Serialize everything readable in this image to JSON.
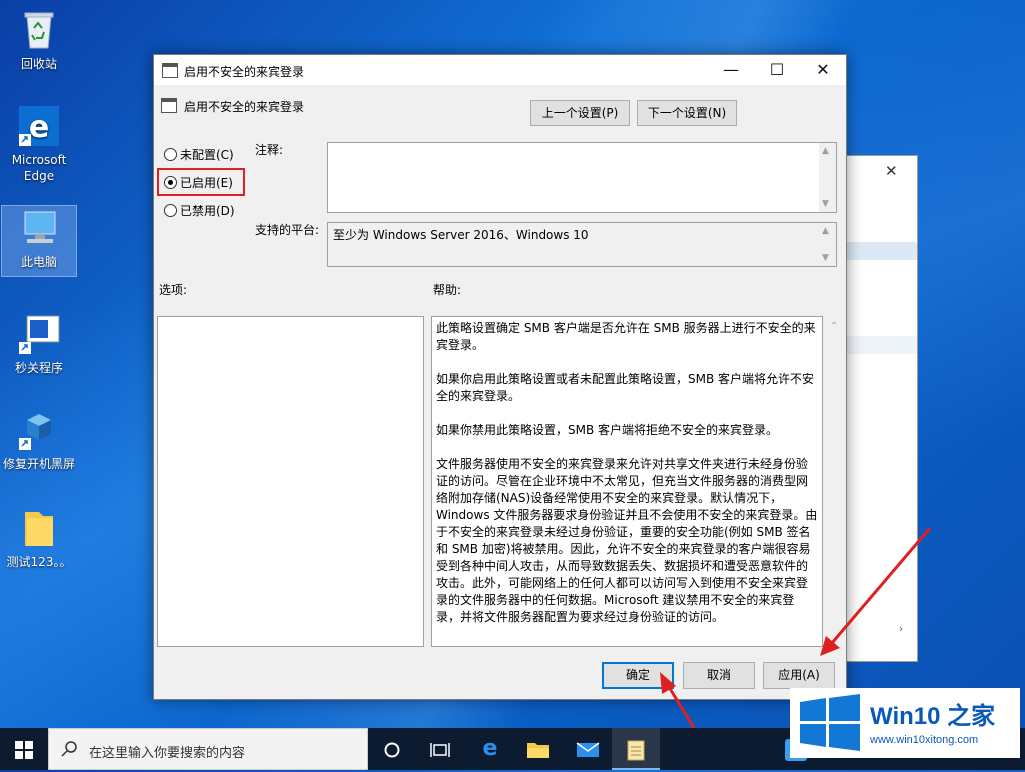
{
  "desktop": {
    "icons": [
      {
        "label": "回收站",
        "icon": "recycle-bin-icon"
      },
      {
        "label": "Microsoft Edge",
        "icon": "edge-icon"
      },
      {
        "label": "此电脑",
        "icon": "computer-icon"
      },
      {
        "label": "秒关程序",
        "icon": "program-icon"
      },
      {
        "label": "修复开机黑屏",
        "icon": "repair-icon"
      },
      {
        "label": "测试123。。",
        "icon": "folder-icon"
      }
    ]
  },
  "dialog": {
    "window_title": "启用不安全的来宾登录",
    "policy_name": "启用不安全的来宾登录",
    "prev_button": "上一个设置(P)",
    "next_button": "下一个设置(N)",
    "radio_options": [
      {
        "label": "未配置(C)",
        "checked": false
      },
      {
        "label": "已启用(E)",
        "checked": true
      },
      {
        "label": "已禁用(D)",
        "checked": false
      }
    ],
    "comment_label": "注释:",
    "comment_value": "",
    "platform_label": "支持的平台:",
    "platform_value": "至少为 Windows Server 2016、Windows 10",
    "options_label": "选项:",
    "help_label": "帮助:",
    "help_paragraphs": [
      "此策略设置确定 SMB 客户端是否允许在 SMB 服务器上进行不安全的来宾登录。",
      "如果你启用此策略设置或者未配置此策略设置，SMB 客户端将允许不安全的来宾登录。",
      "如果你禁用此策略设置，SMB 客户端将拒绝不安全的来宾登录。",
      "文件服务器使用不安全的来宾登录来允许对共享文件夹进行未经身份验证的访问。尽管在企业环境中不太常见，但充当文件服务器的消费型网络附加存储(NAS)设备经常使用不安全的来宾登录。默认情况下，Windows 文件服务器要求身份验证并且不会使用不安全的来宾登录。由于不安全的来宾登录未经过身份验证，重要的安全功能(例如 SMB 签名和 SMB 加密)将被禁用。因此，允许不安全的来宾登录的客户端很容易受到各种中间人攻击，从而导致数据丢失、数据损坏和遭受恶意软件的攻击。此外，可能网络上的任何人都可以访问写入到使用不安全来宾登录的文件服务器中的任何数据。Microsoft 建议禁用不安全的来宾登录，并将文件服务器配置为要求经过身份验证的访问。"
    ],
    "ok_button": "确定",
    "cancel_button": "取消",
    "apply_button": "应用(A)"
  },
  "taskbar": {
    "search_placeholder": "在这里输入你要搜索的内容"
  },
  "watermark": {
    "brand": "Win10 之家",
    "url": "www.win10xitong.com"
  },
  "colors": {
    "accent": "#0078d7",
    "highlight_box": "#e02020",
    "arrow": "#e02020",
    "taskbar": "#0d1b30"
  }
}
